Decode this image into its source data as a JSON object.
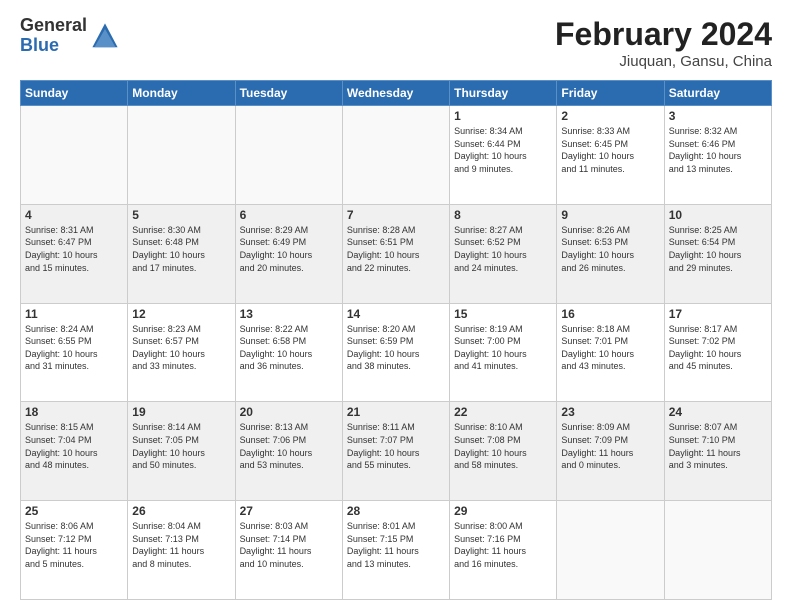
{
  "logo": {
    "general": "General",
    "blue": "Blue"
  },
  "title": "February 2024",
  "subtitle": "Jiuquan, Gansu, China",
  "days_header": [
    "Sunday",
    "Monday",
    "Tuesday",
    "Wednesday",
    "Thursday",
    "Friday",
    "Saturday"
  ],
  "weeks": [
    [
      {
        "day": "",
        "info": ""
      },
      {
        "day": "",
        "info": ""
      },
      {
        "day": "",
        "info": ""
      },
      {
        "day": "",
        "info": ""
      },
      {
        "day": "1",
        "info": "Sunrise: 8:34 AM\nSunset: 6:44 PM\nDaylight: 10 hours\nand 9 minutes."
      },
      {
        "day": "2",
        "info": "Sunrise: 8:33 AM\nSunset: 6:45 PM\nDaylight: 10 hours\nand 11 minutes."
      },
      {
        "day": "3",
        "info": "Sunrise: 8:32 AM\nSunset: 6:46 PM\nDaylight: 10 hours\nand 13 minutes."
      }
    ],
    [
      {
        "day": "4",
        "info": "Sunrise: 8:31 AM\nSunset: 6:47 PM\nDaylight: 10 hours\nand 15 minutes."
      },
      {
        "day": "5",
        "info": "Sunrise: 8:30 AM\nSunset: 6:48 PM\nDaylight: 10 hours\nand 17 minutes."
      },
      {
        "day": "6",
        "info": "Sunrise: 8:29 AM\nSunset: 6:49 PM\nDaylight: 10 hours\nand 20 minutes."
      },
      {
        "day": "7",
        "info": "Sunrise: 8:28 AM\nSunset: 6:51 PM\nDaylight: 10 hours\nand 22 minutes."
      },
      {
        "day": "8",
        "info": "Sunrise: 8:27 AM\nSunset: 6:52 PM\nDaylight: 10 hours\nand 24 minutes."
      },
      {
        "day": "9",
        "info": "Sunrise: 8:26 AM\nSunset: 6:53 PM\nDaylight: 10 hours\nand 26 minutes."
      },
      {
        "day": "10",
        "info": "Sunrise: 8:25 AM\nSunset: 6:54 PM\nDaylight: 10 hours\nand 29 minutes."
      }
    ],
    [
      {
        "day": "11",
        "info": "Sunrise: 8:24 AM\nSunset: 6:55 PM\nDaylight: 10 hours\nand 31 minutes."
      },
      {
        "day": "12",
        "info": "Sunrise: 8:23 AM\nSunset: 6:57 PM\nDaylight: 10 hours\nand 33 minutes."
      },
      {
        "day": "13",
        "info": "Sunrise: 8:22 AM\nSunset: 6:58 PM\nDaylight: 10 hours\nand 36 minutes."
      },
      {
        "day": "14",
        "info": "Sunrise: 8:20 AM\nSunset: 6:59 PM\nDaylight: 10 hours\nand 38 minutes."
      },
      {
        "day": "15",
        "info": "Sunrise: 8:19 AM\nSunset: 7:00 PM\nDaylight: 10 hours\nand 41 minutes."
      },
      {
        "day": "16",
        "info": "Sunrise: 8:18 AM\nSunset: 7:01 PM\nDaylight: 10 hours\nand 43 minutes."
      },
      {
        "day": "17",
        "info": "Sunrise: 8:17 AM\nSunset: 7:02 PM\nDaylight: 10 hours\nand 45 minutes."
      }
    ],
    [
      {
        "day": "18",
        "info": "Sunrise: 8:15 AM\nSunset: 7:04 PM\nDaylight: 10 hours\nand 48 minutes."
      },
      {
        "day": "19",
        "info": "Sunrise: 8:14 AM\nSunset: 7:05 PM\nDaylight: 10 hours\nand 50 minutes."
      },
      {
        "day": "20",
        "info": "Sunrise: 8:13 AM\nSunset: 7:06 PM\nDaylight: 10 hours\nand 53 minutes."
      },
      {
        "day": "21",
        "info": "Sunrise: 8:11 AM\nSunset: 7:07 PM\nDaylight: 10 hours\nand 55 minutes."
      },
      {
        "day": "22",
        "info": "Sunrise: 8:10 AM\nSunset: 7:08 PM\nDaylight: 10 hours\nand 58 minutes."
      },
      {
        "day": "23",
        "info": "Sunrise: 8:09 AM\nSunset: 7:09 PM\nDaylight: 11 hours\nand 0 minutes."
      },
      {
        "day": "24",
        "info": "Sunrise: 8:07 AM\nSunset: 7:10 PM\nDaylight: 11 hours\nand 3 minutes."
      }
    ],
    [
      {
        "day": "25",
        "info": "Sunrise: 8:06 AM\nSunset: 7:12 PM\nDaylight: 11 hours\nand 5 minutes."
      },
      {
        "day": "26",
        "info": "Sunrise: 8:04 AM\nSunset: 7:13 PM\nDaylight: 11 hours\nand 8 minutes."
      },
      {
        "day": "27",
        "info": "Sunrise: 8:03 AM\nSunset: 7:14 PM\nDaylight: 11 hours\nand 10 minutes."
      },
      {
        "day": "28",
        "info": "Sunrise: 8:01 AM\nSunset: 7:15 PM\nDaylight: 11 hours\nand 13 minutes."
      },
      {
        "day": "29",
        "info": "Sunrise: 8:00 AM\nSunset: 7:16 PM\nDaylight: 11 hours\nand 16 minutes."
      },
      {
        "day": "",
        "info": ""
      },
      {
        "day": "",
        "info": ""
      }
    ]
  ]
}
